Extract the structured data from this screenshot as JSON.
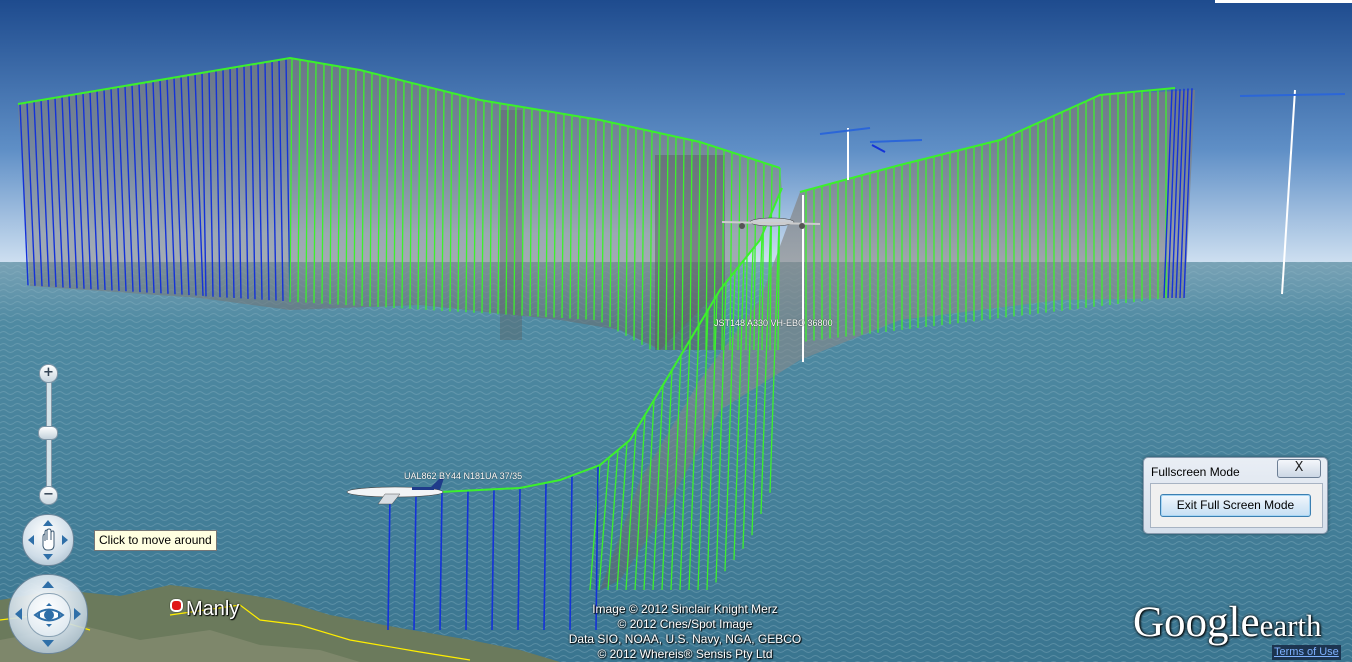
{
  "app": {
    "name": "Google Earth"
  },
  "colors": {
    "sky_top": "#1f4f8f",
    "sky_horizon": "#c9dcf0",
    "ocean": "#3f7a93",
    "track_blue": "#1432d8",
    "track_green": "#3cf02c"
  },
  "navigation": {
    "zoom_in_label": "+",
    "zoom_out_label": "−",
    "move_icon": "hand-icon",
    "look_icon": "eye-icon",
    "tooltip": "Click to move around"
  },
  "fullscreen_dialog": {
    "title": "Fullscreen Mode",
    "close_label": "X",
    "exit_button": "Exit Full Screen Mode"
  },
  "places": [
    {
      "name": "Manly"
    }
  ],
  "flight_labels": [
    {
      "text": "UAL862 BY44 N181UA 37/35"
    },
    {
      "text": "JST148 A330 VH-EBO 36800"
    }
  ],
  "attribution": [
    "Image © 2012 Sinclair Knight Merz",
    "© 2012 Cnes/Spot Image",
    "Data SIO, NOAA, U.S. Navy, NGA, GEBCO",
    "© 2012 Whereis® Sensis Pty Ltd"
  ],
  "logo": {
    "google": "Google",
    "earth": "earth"
  },
  "terms_link": "Terms of Use"
}
